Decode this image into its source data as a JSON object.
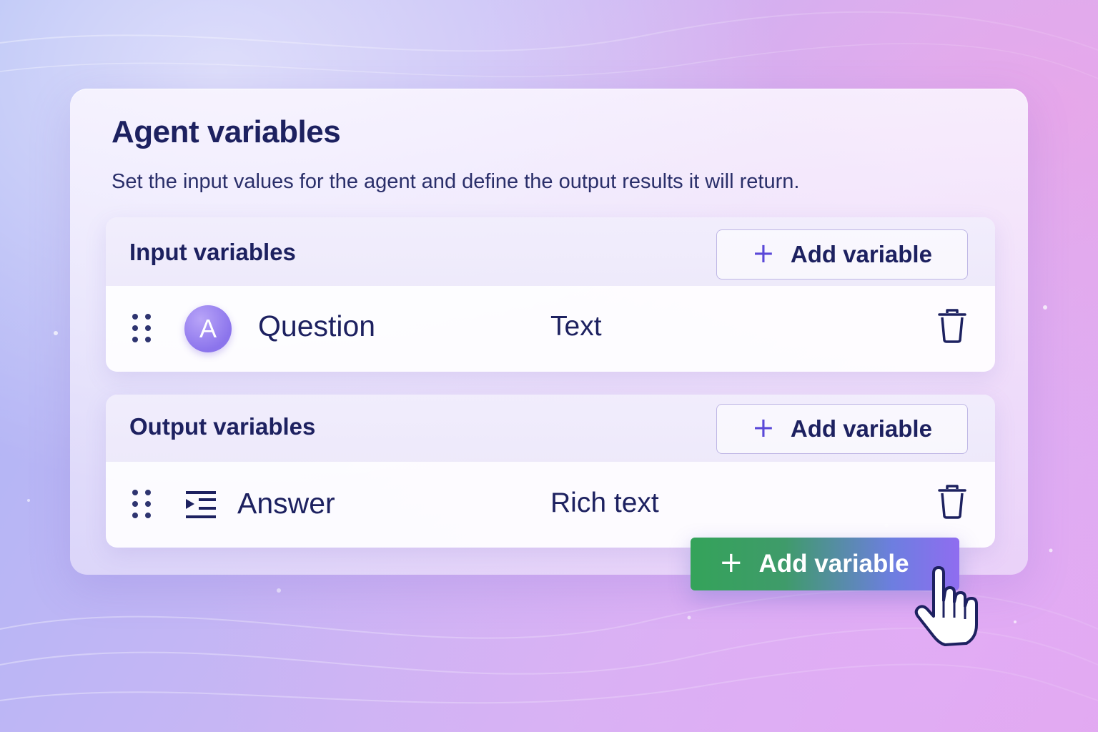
{
  "panel": {
    "title": "Agent variables",
    "subtitle": "Set the input values for the agent and define the output results it will return."
  },
  "input_section": {
    "title": "Input variables",
    "add_button": {
      "icon": "plus-icon",
      "label": "Add variable"
    },
    "rows": [
      {
        "avatar_letter": "A",
        "name": "Question",
        "type": "Text",
        "icon": "text-type-avatar"
      }
    ]
  },
  "output_section": {
    "title": "Output variables",
    "add_button": {
      "icon": "plus-icon",
      "label": "Add variable"
    },
    "rows": [
      {
        "name": "Answer",
        "type": "Rich text",
        "icon": "rich-text-icon"
      }
    ]
  },
  "highlight_button": {
    "icon": "plus-icon",
    "label": "Add variable"
  },
  "colors": {
    "text_primary": "#1d2160",
    "accent": "#5a48d8",
    "cta_start": "#34a35a",
    "cta_end": "#8f6df0"
  }
}
